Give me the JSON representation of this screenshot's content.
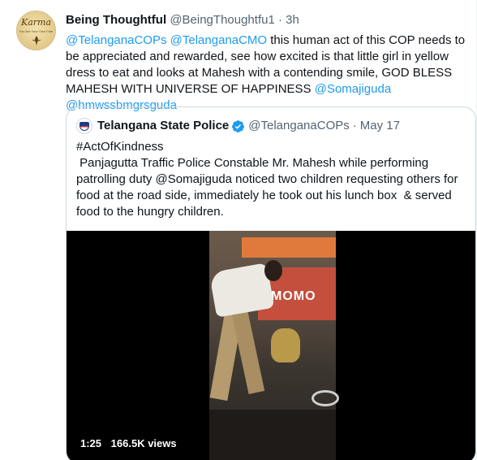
{
  "tweet": {
    "author_name": "Being Thoughtful",
    "author_handle": "@BeingThoughtfu1",
    "separator": "·",
    "time": "3h",
    "avatar": {
      "brand_text": "Karma",
      "subtext": "You Are Your Own Fate"
    },
    "text": {
      "mention1": "@TelanganaCOPs",
      "mention2": "@TelanganaCMO",
      "body": " this human act of this COP needs to be appreciated and rewarded, see how excited is that little girl in yellow dress to eat and looks at Mahesh with a contending smile, GOD BLESS MAHESH WITH UNIVERSE OF HAPPINESS ",
      "mention3": "@Somajiguda",
      "mention4": "@hmwssbmgrsguda"
    }
  },
  "quote": {
    "author_name": "Telangana State Police",
    "author_handle": "@TelanganaCOPs",
    "separator": "·",
    "date": "May 17",
    "verified_icon": "verified-badge-icon",
    "text_lines": [
      "#ActOfKindness",
      " Panjagutta Traffic Police Constable Mr. Mahesh while performing",
      "patrolling duty @Somajiguda noticed two children requesting others for",
      "food at the road side, immediately he took out his lunch box  & served",
      "food to the hungry children."
    ],
    "video": {
      "duration": "1:25",
      "views": "166.5K views",
      "sign_text": "MOMO"
    }
  },
  "colors": {
    "link": "#1d9bf0",
    "text": "#0f1419",
    "meta": "#536471",
    "border": "#cfd9de",
    "verified": "#1d9bf0"
  }
}
